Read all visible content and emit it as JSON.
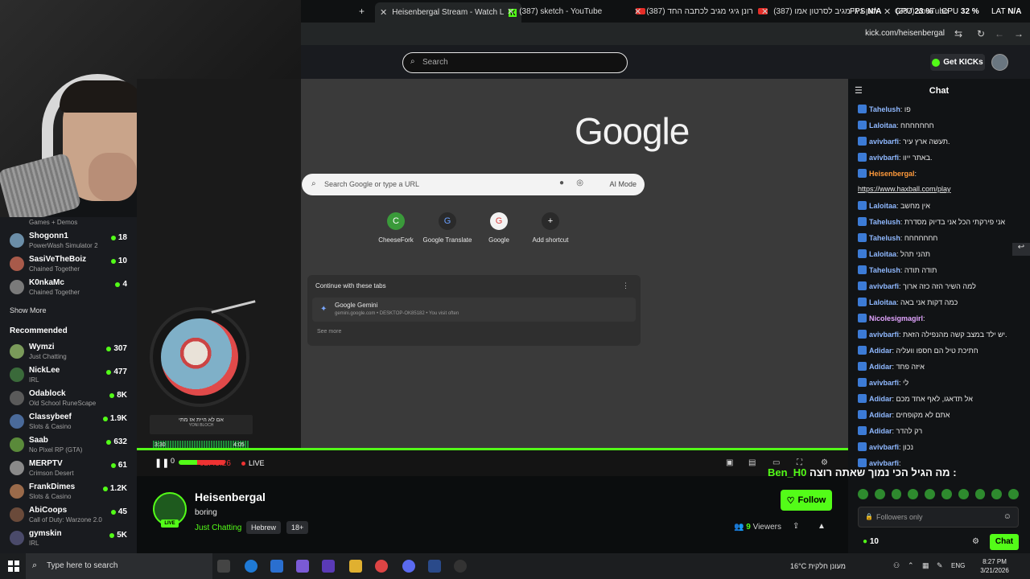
{
  "browser": {
    "tabs": [
      {
        "label": "Heisenbergal Stream - Watch L",
        "active": true
      },
      {
        "label": "(387) sketch - YouTube"
      },
      {
        "label": "(387) רונן גיגי מגיב לכתבה החד"
      },
      {
        "label": "(387) רונן גיגי מגיב לסרטון אמו"
      },
      {
        "label": "(387) YouTube"
      }
    ],
    "url": "kick.com/heisenbergal",
    "perf": {
      "fps_label": "FPS",
      "fps": "N/A",
      "gpu_label": "GPU",
      "gpu": "23 %",
      "cpu_label": "CPU",
      "cpu": "32 %",
      "lat_label": "LAT",
      "lat": "N/A"
    }
  },
  "kick_header": {
    "search_placeholder": "Search",
    "get_kicks": "Get KICKs"
  },
  "sidebar": {
    "partial_top": "Games + Demos",
    "following": [
      {
        "name": "Shogonn1",
        "category": "PowerWash Simulator 2",
        "viewers": "18",
        "color": "#6b8ea8"
      },
      {
        "name": "SasiVeTheBoiz",
        "category": "Chained Together",
        "viewers": "10",
        "color": "#a85a4a"
      },
      {
        "name": "K0nkaMc",
        "category": "Chained Together",
        "viewers": "4",
        "color": "#7a7a7a"
      }
    ],
    "show_more": "Show More",
    "recommended_label": "Recommended",
    "recommended": [
      {
        "name": "Wymzi",
        "category": "Just Chatting",
        "viewers": "307",
        "color": "#7a9a5a"
      },
      {
        "name": "NickLee",
        "category": "IRL",
        "viewers": "477",
        "color": "#3a6a3a"
      },
      {
        "name": "Odablock",
        "category": "Old School RuneScape",
        "viewers": "8K",
        "color": "#5a5a5a"
      },
      {
        "name": "Classybeef",
        "category": "Slots & Casino",
        "viewers": "1.9K",
        "color": "#4a6a9a"
      },
      {
        "name": "Saab",
        "category": "No Pixel RP (GTA)",
        "viewers": "632",
        "color": "#5a8a3a"
      },
      {
        "name": "MERPTV",
        "category": "Crimson Desert",
        "viewers": "61",
        "color": "#8a8a8a"
      },
      {
        "name": "FrankDimes",
        "category": "Slots & Casino",
        "viewers": "1.2K",
        "color": "#9a6a4a"
      },
      {
        "name": "AbiCoops",
        "category": "Call of Duty: Warzone 2.0",
        "viewers": "45",
        "color": "#6a4a3a"
      },
      {
        "name": "gymskin",
        "category": "IRL",
        "viewers": "5K",
        "color": "#4a4a6a"
      }
    ]
  },
  "screen_share": {
    "google_logo": "Google",
    "search_placeholder": "Search Google or type a URL",
    "ai_mode": "AI Mode",
    "shortcuts": [
      {
        "label": "CheeseFork",
        "icon": "C"
      },
      {
        "label": "Google Translate",
        "icon": "G"
      },
      {
        "label": "Google",
        "icon": "G"
      },
      {
        "label": "Add shortcut",
        "icon": "+"
      }
    ],
    "continue_title": "Continue with these tabs",
    "continue_item_title": "Google Gemini",
    "continue_item_sub": "gemini.google.com • DESKTOP-OK85182 • You visit often",
    "see_more": "See more"
  },
  "music_widget": {
    "song": "אם לא היית אז מתי",
    "artist": "YONI BLOCH",
    "time_start": "3:30",
    "time_end": "4:05"
  },
  "player": {
    "timecode": "02:45:26",
    "live": "LIVE",
    "volume_label": "0",
    "progress": 1.0
  },
  "stream": {
    "channel": "Heisenbergal",
    "live_badge": "LIVE",
    "title": "boring",
    "category": "Just Chatting",
    "tags": [
      "Hebrew",
      "18+"
    ],
    "follow": "Follow",
    "viewers_count": "9",
    "viewers_label": "Viewers"
  },
  "chat": {
    "title": "Chat",
    "messages": [
      {
        "user": "Tahelush",
        "text": "פו"
      },
      {
        "user": "Laloitaa",
        "text": "חחחחחחח"
      },
      {
        "user": "avivbarfi",
        "text": "תעשה ארץ עיר."
      },
      {
        "user": "avivbarfi",
        "text": "באתר ייוו."
      },
      {
        "user": "Heisenbergal",
        "text": ""
      },
      {
        "user": "",
        "text": "https://www.haxball.com/play"
      },
      {
        "user": "Laloitaa",
        "text": "אין מחשב"
      },
      {
        "user": "Tahelush",
        "text": "אני פירקתי הכל אני בדיוק מסדרת"
      },
      {
        "user": "Tahelush",
        "text": "חחחחחחח"
      },
      {
        "user": "Laloitaa",
        "text": "תהני תהל"
      },
      {
        "user": "Tahelush",
        "text": "תודה תודה"
      },
      {
        "user": "avivbarfi",
        "text": "למה השיר הזה כזה ארוך"
      },
      {
        "user": "Laloitaa",
        "text": "כמה דקות אני באה"
      },
      {
        "user": "Nicolesigmagirl",
        "text": ""
      },
      {
        "user": "avivbarfi",
        "text": "יש ילד במצב קשה מהנפילה הזאת."
      },
      {
        "user": "Adidar",
        "text": "חתיכת טיל הם חספו וועליה"
      },
      {
        "user": "Adidar",
        "text": "איזה פחד"
      },
      {
        "user": "avivbarfi",
        "text": "לי"
      },
      {
        "user": "Adidar",
        "text": "אל תדאגו, לאף אחד מכם"
      },
      {
        "user": "Adidar",
        "text": "אתם לא מקופחים"
      },
      {
        "user": "Adidar",
        "text": "רק להדר"
      },
      {
        "user": "avivbarfi",
        "text": "נכון"
      },
      {
        "user": "avivbarfi",
        "text": ""
      }
    ],
    "overlay_user": "Ben_H0",
    "overlay_text": "מה הגיל הכי נמוך שאתה רוצה :",
    "input_placeholder": "Followers only",
    "kicks_amount": "10",
    "send": "Chat"
  },
  "taskbar": {
    "search": "Type here to search",
    "weather": "16°C מעונן חלקית",
    "lang": "ENG",
    "time": "8:27 PM",
    "date": "3/21/2026"
  }
}
